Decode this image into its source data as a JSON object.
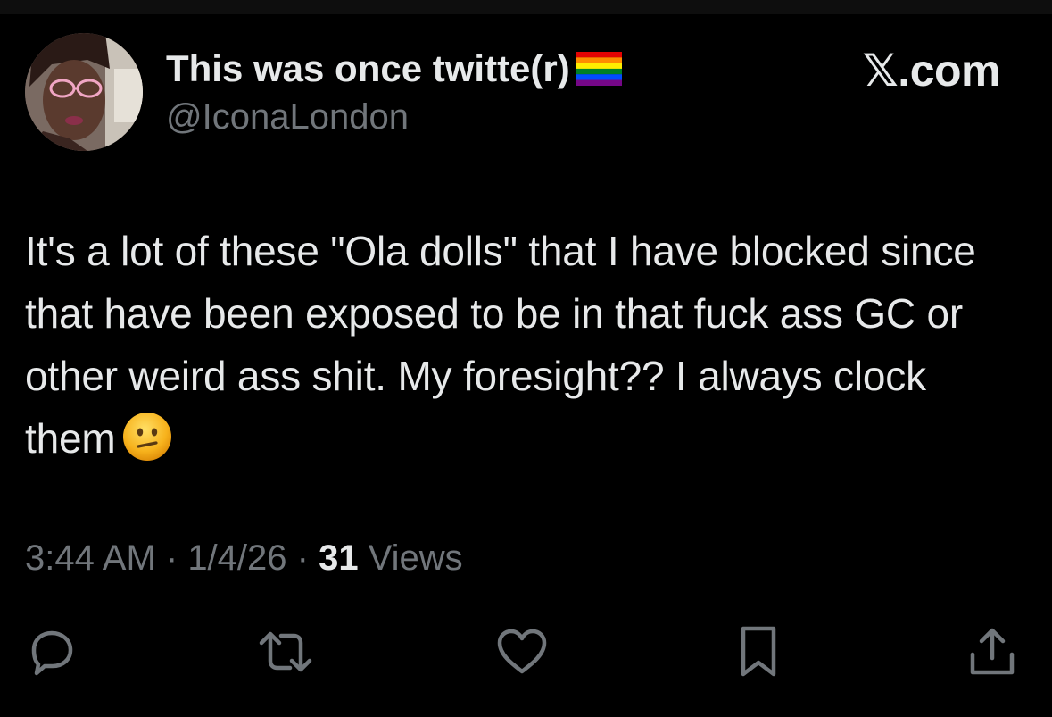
{
  "author": {
    "display_name": "This was once twitte(r)",
    "flag_icon": "rainbow-flag-icon",
    "handle": "@IconaLondon",
    "avatar_icon": "user-avatar"
  },
  "brand": {
    "label": "𝕏.com"
  },
  "tweet": {
    "text": "It's a lot of these \"Ola dolls\" that I have blocked since that have been exposed to be in that fuck ass GC or other weird ass shit. My foresight?? I always clock them",
    "emoji_icon": "neutral-face-emoji-icon"
  },
  "meta": {
    "time": "3:44 AM",
    "separator": " · ",
    "date": "1/4/26",
    "views_count": "31",
    "views_label": " Views"
  },
  "actions": {
    "reply_icon": "reply-icon",
    "repost_icon": "repost-icon",
    "like_icon": "heart-icon",
    "bookmark_icon": "bookmark-icon",
    "share_icon": "share-icon"
  },
  "colors": {
    "background": "#000000",
    "primary_text": "#e7e9ea",
    "secondary_text": "#71767b"
  }
}
